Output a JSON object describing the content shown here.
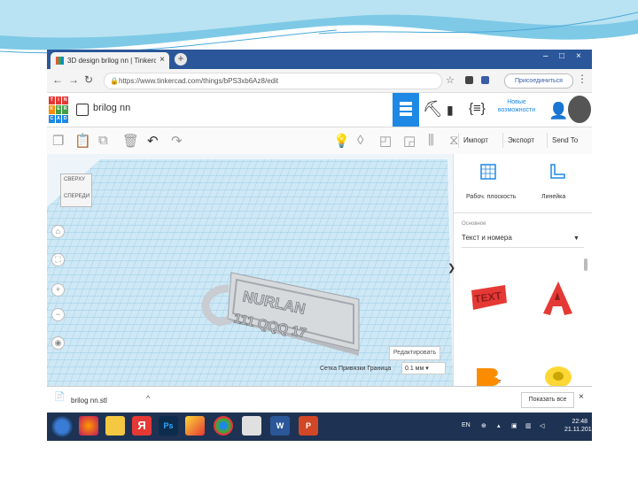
{
  "browser": {
    "tab_title": "3D design brilog nn | Tinkercad",
    "tab_close": "×",
    "new_tab": "+",
    "url": "https://www.tinkercad.com/things/bPS3xb6Az8/edit",
    "user_button": "Присоединиться",
    "minimize": "–",
    "maximize": "□",
    "close": "×"
  },
  "tinkercad": {
    "logo_letters": [
      "TIN",
      "KER",
      "CAD"
    ],
    "project_name": "brilog nn",
    "help_link": "Новые возможности"
  },
  "toolbar": {
    "import": "Импорт",
    "export": "Экспорт",
    "send_to": "Send To"
  },
  "workspace": {
    "viewcube_top": "СВЕРХУ",
    "viewcube_front": "СПЕРЕДИ",
    "model_line1": "NURLAN",
    "model_line2": "111 QQQ 17",
    "edit_grid": "Редактировать",
    "snap_grid_label": "Сетка Привязки Граница",
    "snap_grid_value": "0.1 мм"
  },
  "panel": {
    "workplane": "Рабоч. плоскость",
    "ruler": "Линейка",
    "library_label": "Основное",
    "library_value": "Текст и номера",
    "shape1_label": "Текст",
    "shape2_label": "A"
  },
  "download": {
    "filename": "brilog nn.stl",
    "show_all": "Показать все",
    "close": "×"
  },
  "taskbar": {
    "lang": "EN",
    "time": "22:48",
    "date": "21.11.2018"
  },
  "colors": {
    "tinkercad_blue": "#1e88e5",
    "taskbar": "#1e3354",
    "tab_strip": "#2b579a",
    "shape_red": "#e53935",
    "shape_orange": "#fb8c00",
    "shape_yellow": "#fdd835"
  }
}
